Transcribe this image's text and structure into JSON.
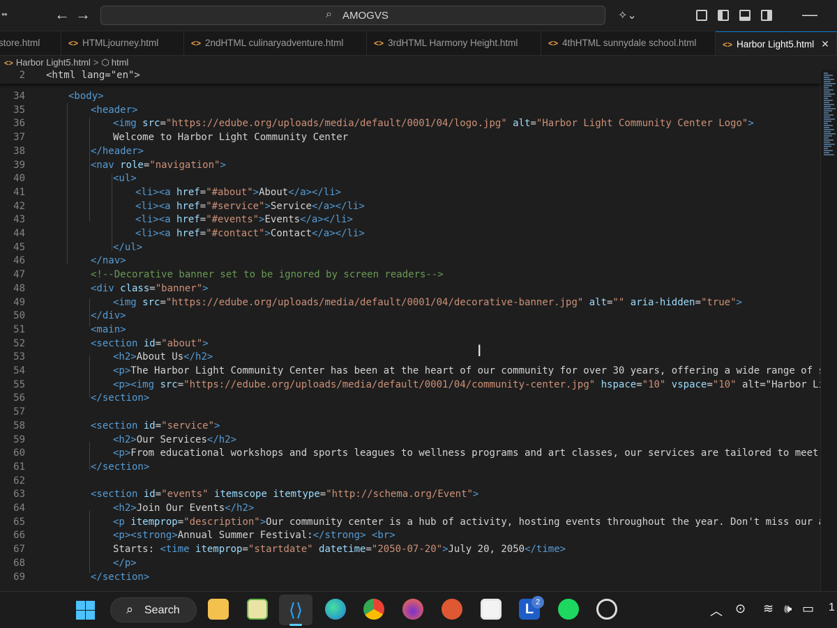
{
  "titlebar": {
    "search_text": "AMOGVS"
  },
  "tabs": [
    {
      "label": "store.html",
      "active": false
    },
    {
      "label": "HTMLjourney.html",
      "active": false
    },
    {
      "label": "2ndHTML culinaryadventure.html",
      "active": false
    },
    {
      "label": "3rdHTML Harmony Height.html",
      "active": false
    },
    {
      "label": "4thHTML sunnydale school.html",
      "active": false
    },
    {
      "label": "Harbor Light5.html",
      "active": true
    }
  ],
  "breadcrumb": {
    "file": "Harbor Light5.html",
    "element": "html"
  },
  "editor": {
    "sticky_line": {
      "number": "2",
      "text": "<html lang=\"en\">"
    },
    "lines": [
      {
        "number": "34",
        "text": "<body>"
      },
      {
        "number": "35",
        "text": "<header>"
      },
      {
        "number": "36",
        "text": "<img src=\"https://edube.org/uploads/media/default/0001/04/logo.jpg\" alt=\"Harbor Light Community Center Logo\">"
      },
      {
        "number": "37",
        "text": "Welcome to Harbor Light Community Center"
      },
      {
        "number": "38",
        "text": "</header>"
      },
      {
        "number": "39",
        "text": "<nav role=\"navigation\">"
      },
      {
        "number": "40",
        "text": "<ul>"
      },
      {
        "number": "41",
        "text": "<li><a href=\"#about\">About</a></li>"
      },
      {
        "number": "42",
        "text": "<li><a href=\"#service\">Service</a></li>"
      },
      {
        "number": "43",
        "text": "<li><a href=\"#events\">Events</a></li>"
      },
      {
        "number": "44",
        "text": "<li><a href=\"#contact\">Contact</a></li>"
      },
      {
        "number": "45",
        "text": "</ul>"
      },
      {
        "number": "46",
        "text": "</nav>"
      },
      {
        "number": "47",
        "text": "<!--Decorative banner set to be ignored by screen readers-->"
      },
      {
        "number": "48",
        "text": "<div class=\"banner\">"
      },
      {
        "number": "49",
        "text": "<img src=\"https://edube.org/uploads/media/default/0001/04/decorative-banner.jpg\" alt=\"\" aria-hidden=\"true\">"
      },
      {
        "number": "50",
        "text": "</div>"
      },
      {
        "number": "51",
        "text": "<main>"
      },
      {
        "number": "52",
        "text": "<section id=\"about\">"
      },
      {
        "number": "53",
        "text": "<h2>About Us</h2>"
      },
      {
        "number": "54",
        "text": "<p>The Harbor Light Community Center has been at the heart of our community for over 30 years, offering a wide range of services and"
      },
      {
        "number": "55",
        "text": "<p><img src=\"https://edube.org/uploads/media/default/0001/04/community-center.jpg\" hspace=\"10\" vspace=\"10\" alt=\"Harbor Light Communi"
      },
      {
        "number": "56",
        "text": "</section>"
      },
      {
        "number": "57",
        "text": ""
      },
      {
        "number": "58",
        "text": "<section id=\"service\">"
      },
      {
        "number": "59",
        "text": "<h2>Our Services</h2>"
      },
      {
        "number": "60",
        "text": "<p>From educational workshops and sports leagues to wellness programs and art classes, our services are tailored to meet the diverse"
      },
      {
        "number": "61",
        "text": "</section>"
      },
      {
        "number": "62",
        "text": ""
      },
      {
        "number": "63",
        "text": "<section id=\"events\" itemscope itemtype=\"http://schema.org/Event\">"
      },
      {
        "number": "64",
        "text": "<h2>Join Our Events</h2>"
      },
      {
        "number": "65",
        "text": "<p itemprop=\"description\">Our community center is a hub of activity, hosting events throughout the year. Don't miss our annual summe"
      },
      {
        "number": "66",
        "text": "<p><strong>Annual Summer Festival:</strong> <br>"
      },
      {
        "number": "67",
        "text": "Starts: <time itemprop=\"startdate\" datetime=\"2050-07-20\">July 20, 2050</time>"
      },
      {
        "number": "68",
        "text": "</p>"
      },
      {
        "number": "69",
        "text": "</section>"
      }
    ]
  },
  "taskbar": {
    "search_label": "Search",
    "badge_count": "2",
    "clock_partial": "1",
    "apps": [
      "file-explorer",
      "notepad",
      "vscode",
      "edge",
      "chrome",
      "firefox",
      "duckduckgo",
      "microsoft-store",
      "l-app",
      "spotify",
      "obs"
    ]
  }
}
